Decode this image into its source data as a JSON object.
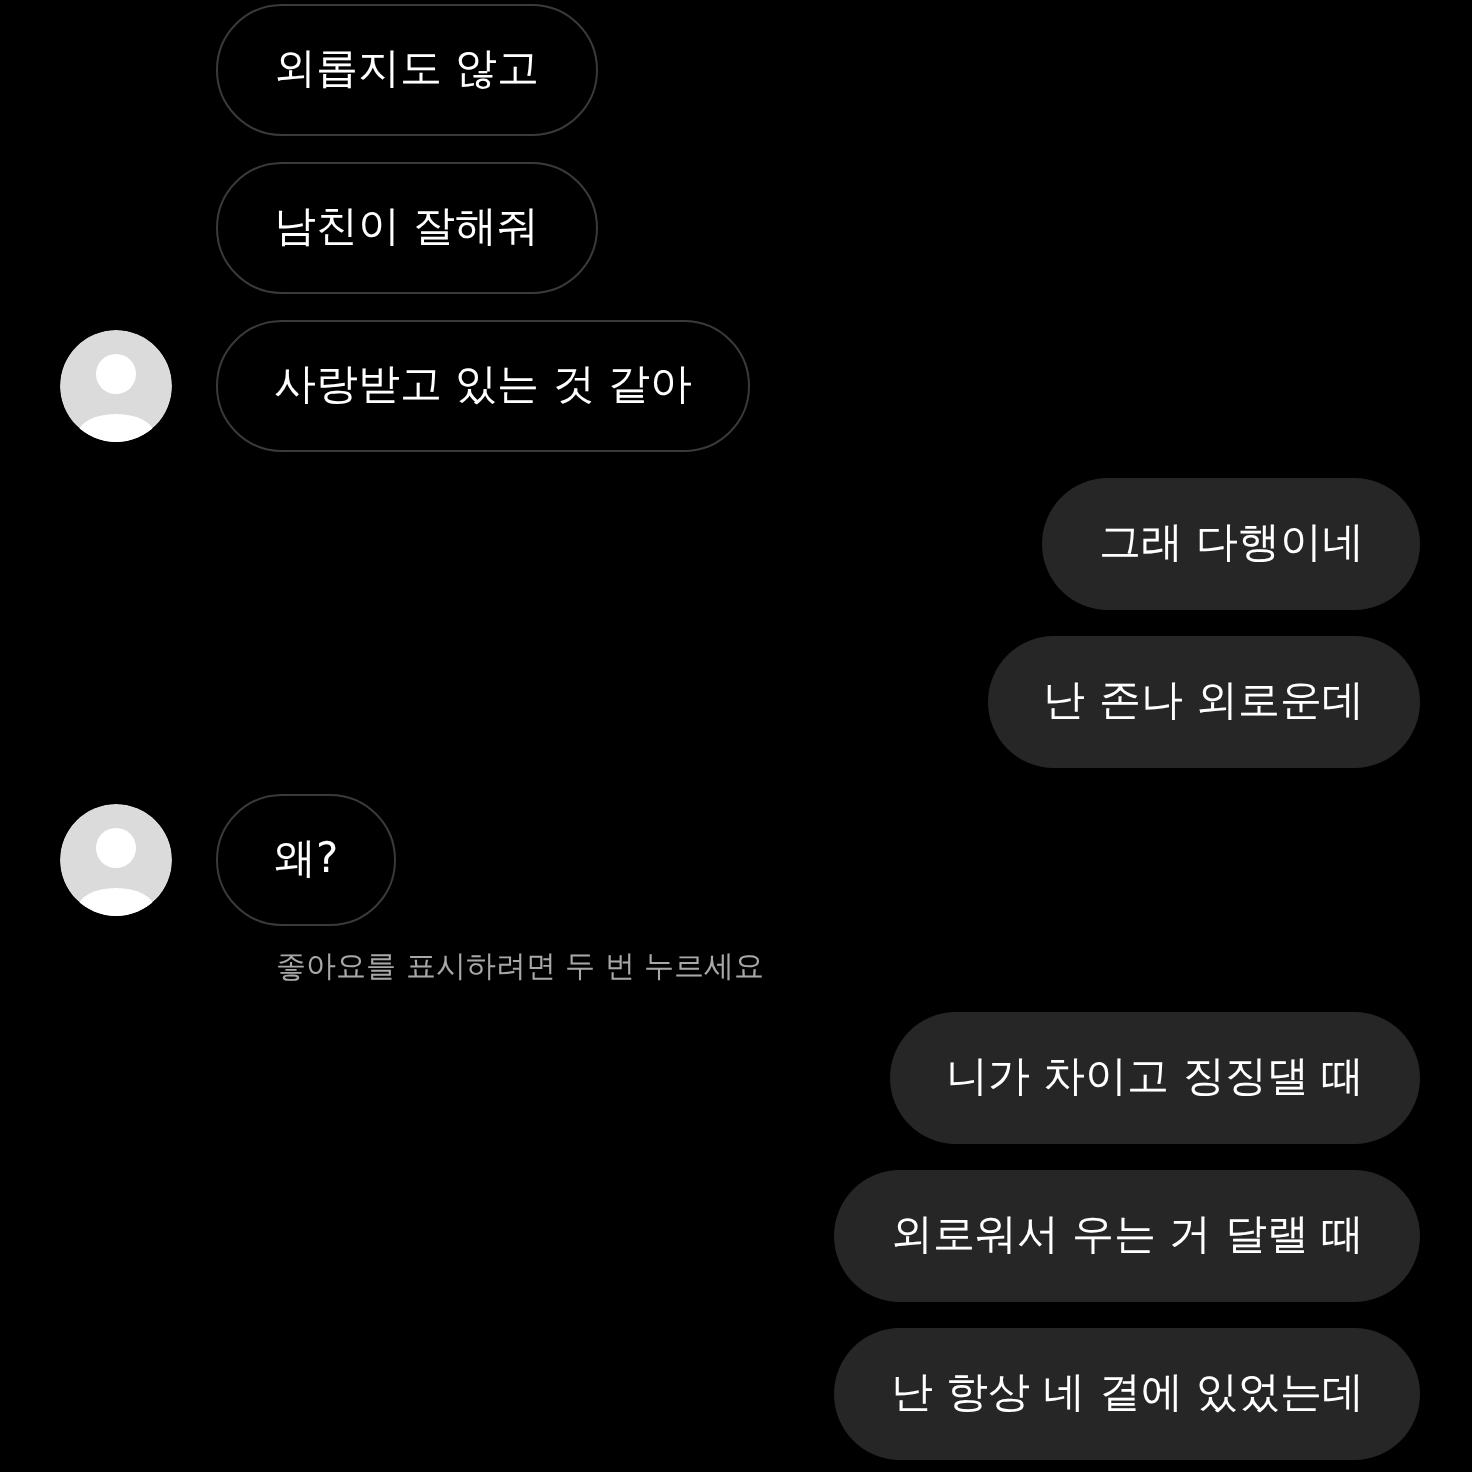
{
  "messages": [
    {
      "kind": "incoming",
      "text": "외롭지도 않고",
      "avatar": false
    },
    {
      "kind": "incoming",
      "text": "남친이 잘해줘",
      "avatar": false
    },
    {
      "kind": "incoming",
      "text": "사랑받고 있는 것 같아",
      "avatar": true
    },
    {
      "kind": "outgoing",
      "text": "그래 다행이네"
    },
    {
      "kind": "outgoing",
      "text": "난 존나 외로운데"
    },
    {
      "kind": "incoming",
      "text": "왜?",
      "avatar": true,
      "hint": "좋아요를 표시하려면 두 번 누르세요"
    },
    {
      "kind": "outgoing",
      "text": "니가 차이고 징징댈 때"
    },
    {
      "kind": "outgoing",
      "text": "외로워서 우는 거 달랠 때"
    },
    {
      "kind": "outgoing",
      "text": "난 항상 네 곁에 있었는데"
    }
  ]
}
